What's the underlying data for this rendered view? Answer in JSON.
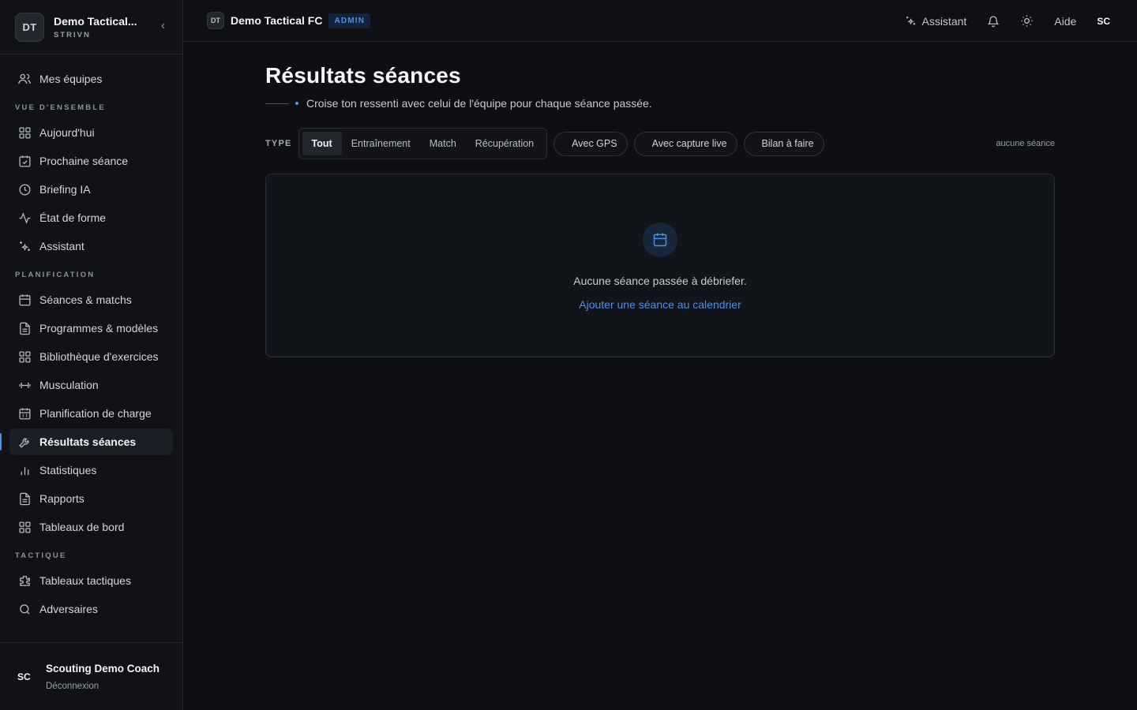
{
  "sidebar": {
    "org_initials": "DT",
    "org_name": "Demo Tactical...",
    "org_sub": "STRIVN",
    "my_teams": "Mes équipes",
    "sections": {
      "overview": "VUE D'ENSEMBLE",
      "planning": "PLANIFICATION",
      "tactics": "TACTIQUE"
    },
    "items": {
      "today": "Aujourd'hui",
      "next_session": "Prochaine séance",
      "briefing": "Briefing IA",
      "form": "État de forme",
      "assistant": "Assistant",
      "sessions_matches": "Séances & matchs",
      "programs": "Programmes & modèles",
      "library": "Bibliothèque d'exercices",
      "strength": "Musculation",
      "load_planning": "Planification de charge",
      "session_results": "Résultats séances",
      "statistics": "Statistiques",
      "reports": "Rapports",
      "dashboards": "Tableaux de bord",
      "tactical_boards": "Tableaux tactiques",
      "opponents": "Adversaires"
    },
    "user": {
      "initials": "SC",
      "name": "Scouting Demo Coach",
      "logout": "Déconnexion"
    }
  },
  "topbar": {
    "team_initials": "DT",
    "team_name": "Demo Tactical FC",
    "badge": "ADMIN",
    "assistant": "Assistant",
    "help": "Aide",
    "user_initials": "SC"
  },
  "main": {
    "title": "Résultats séances",
    "subtitle": "Croise ton ressenti avec celui de l'équipe pour chaque séance passée.",
    "type_label": "TYPE",
    "type_tabs": [
      "Tout",
      "Entraînement",
      "Match",
      "Récupération"
    ],
    "filters": [
      "Avec GPS",
      "Avec capture live",
      "Bilan à faire"
    ],
    "count": "aucune séance",
    "empty_text": "Aucune séance passée à débriefer.",
    "empty_link": "Ajouter une séance au calendrier"
  },
  "colors": {
    "accent": "#4d8fe6",
    "background": "#0d0f12"
  }
}
